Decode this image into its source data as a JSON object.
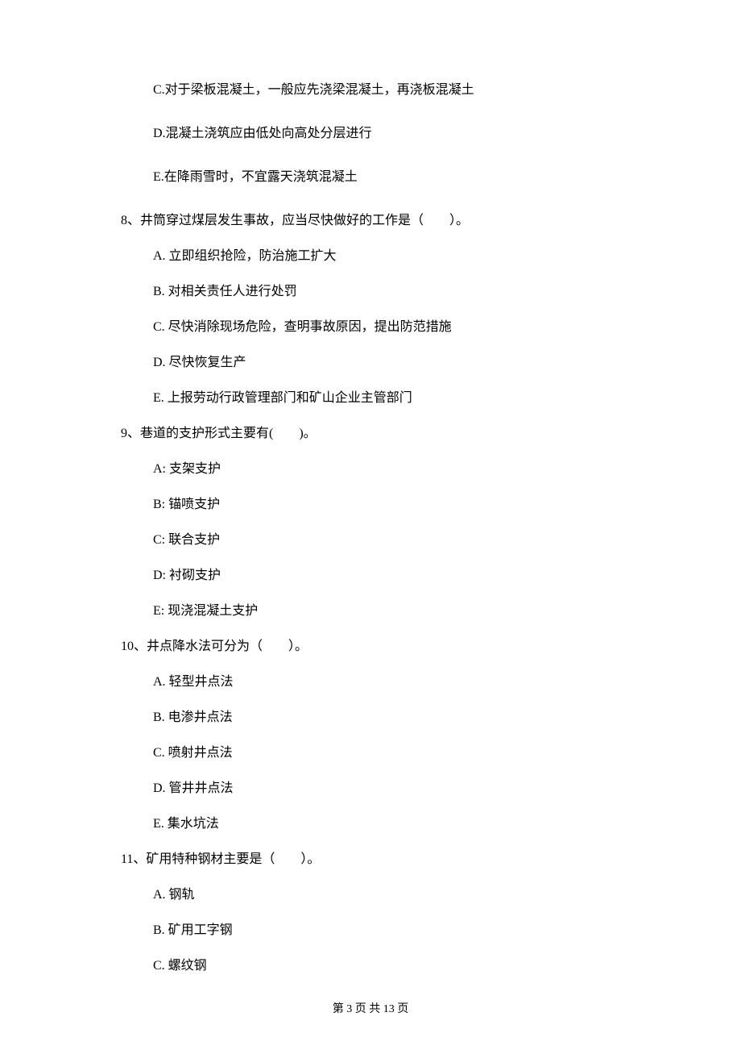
{
  "continuedOptions": [
    "C.对于梁板混凝土，一般应先浇梁混凝土，再浇板混凝土",
    "D.混凝土浇筑应由低处向高处分层进行",
    "E.在降雨雪时，不宜露天浇筑混凝土"
  ],
  "questions": [
    {
      "stem": "8、井筒穿过煤层发生事故，应当尽快做好的工作是（　　）。",
      "options": [
        "A.  立即组织抢险，防治施工扩大",
        "B.  对相关责任人进行处罚",
        "C.  尽快消除现场危险，查明事故原因，提出防范措施",
        "D.  尽快恢复生产",
        "E.  上报劳动行政管理部门和矿山企业主管部门"
      ]
    },
    {
      "stem": "9、巷道的支护形式主要有(　　)。",
      "options": [
        "A:  支架支护",
        "B:  锚喷支护",
        "C:  联合支护",
        "D:  衬砌支护",
        "E:  现浇混凝土支护"
      ]
    },
    {
      "stem": "10、井点降水法可分为（　　）。",
      "options": [
        "A.  轻型井点法",
        "B.  电渗井点法",
        "C.  喷射井点法",
        "D.  管井井点法",
        "E.  集水坑法"
      ]
    },
    {
      "stem": "11、矿用特种钢材主要是（　　）。",
      "options": [
        "A.  钢轨",
        "B.  矿用工字钢",
        "C.  螺纹钢"
      ]
    }
  ],
  "footer": "第 3 页 共 13 页"
}
